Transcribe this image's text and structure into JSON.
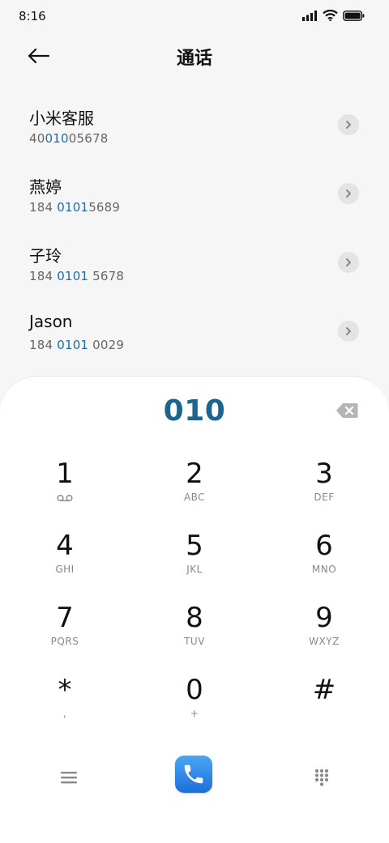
{
  "status": {
    "time": "8:16"
  },
  "header": {
    "title": "通话"
  },
  "contacts": [
    {
      "name": "小米客服",
      "number_parts": [
        "40",
        "010",
        "05678"
      ]
    },
    {
      "name": "燕婷",
      "number_parts": [
        "184 ",
        "0101",
        "5689"
      ]
    },
    {
      "name": "子玲",
      "number_parts": [
        "184 ",
        "0101",
        " 5678"
      ]
    },
    {
      "name": "Jason",
      "number_parts": [
        "184 ",
        "0101",
        " 0029"
      ]
    }
  ],
  "dialer": {
    "dialed_number": "010",
    "keys": [
      {
        "digit": "1",
        "letters": ""
      },
      {
        "digit": "2",
        "letters": "ABC"
      },
      {
        "digit": "3",
        "letters": "DEF"
      },
      {
        "digit": "4",
        "letters": "GHI"
      },
      {
        "digit": "5",
        "letters": "JKL"
      },
      {
        "digit": "6",
        "letters": "MNO"
      },
      {
        "digit": "7",
        "letters": "PQRS"
      },
      {
        "digit": "8",
        "letters": "TUV"
      },
      {
        "digit": "9",
        "letters": "WXYZ"
      },
      {
        "digit": "*",
        "letters": ","
      },
      {
        "digit": "0",
        "letters": "+"
      },
      {
        "digit": "#",
        "letters": ""
      }
    ]
  },
  "colors": {
    "highlight": "#1a6ea2",
    "call_button": "#2a86e6",
    "dialed_text": "#1d6591"
  },
  "icons": [
    "back-arrow-icon",
    "chevron-right-icon",
    "backspace-icon",
    "voicemail-icon",
    "menu-icon",
    "phone-icon",
    "dialpad-icon",
    "signal-icon",
    "wifi-icon",
    "battery-icon"
  ]
}
